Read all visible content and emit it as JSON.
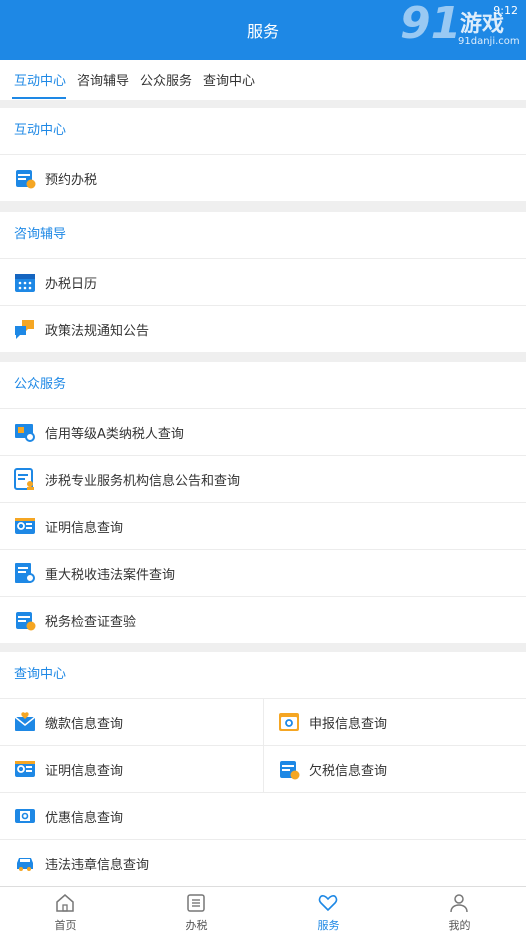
{
  "header": {
    "title": "服务",
    "time": "9:12"
  },
  "watermark": {
    "big": "91",
    "game": "游戏",
    "url": "91danji.com"
  },
  "tabs": [
    {
      "label": "互动中心"
    },
    {
      "label": "咨询辅导"
    },
    {
      "label": "公众服务"
    },
    {
      "label": "查询中心"
    }
  ],
  "sections": {
    "interaction": {
      "title": "互动中心",
      "items": [
        {
          "label": "预约办税"
        }
      ]
    },
    "consult": {
      "title": "咨询辅导",
      "items": [
        {
          "label": "办税日历"
        },
        {
          "label": "政策法规通知公告"
        }
      ]
    },
    "public": {
      "title": "公众服务",
      "items": [
        {
          "label": "信用等级A类纳税人查询"
        },
        {
          "label": "涉税专业服务机构信息公告和查询"
        },
        {
          "label": "证明信息查询"
        },
        {
          "label": "重大税收违法案件查询"
        },
        {
          "label": "税务检查证查验"
        }
      ]
    },
    "query": {
      "title": "查询中心",
      "items": [
        {
          "label": "缴款信息查询"
        },
        {
          "label": "申报信息查询"
        },
        {
          "label": "证明信息查询"
        },
        {
          "label": "欠税信息查询"
        },
        {
          "label": "优惠信息查询"
        },
        {
          "label": "违法违章信息查询"
        }
      ]
    }
  },
  "bottom_nav": [
    {
      "label": "首页"
    },
    {
      "label": "办税"
    },
    {
      "label": "服务"
    },
    {
      "label": "我的"
    }
  ],
  "colors": {
    "primary": "#1e88e5",
    "icon_orange": "#f5a623",
    "background": "#efefef"
  }
}
